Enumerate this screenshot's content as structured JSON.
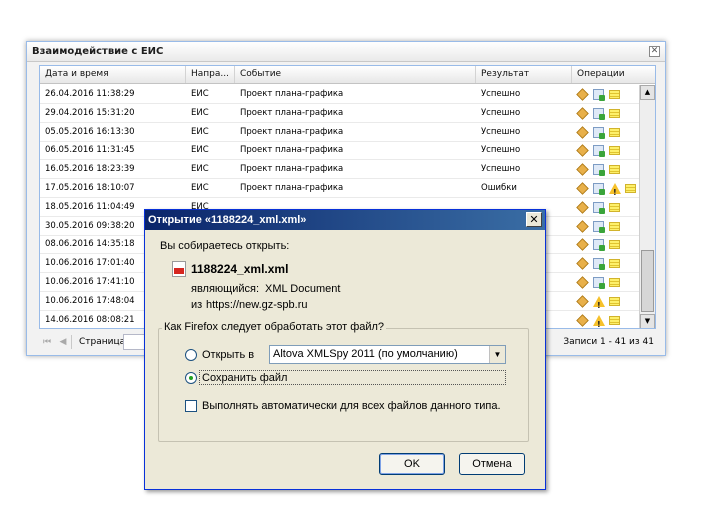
{
  "eis_window": {
    "title": "Взаимодействие с ЕИС",
    "close_glyph": "✕",
    "columns": [
      "Дата и время",
      "Напра...",
      "Событие",
      "Результат",
      "Операции"
    ],
    "rows": [
      {
        "date": "26.04.2016 11:38:29",
        "dir": "ЕИС",
        "event": "Проект плана-графика",
        "result": "Успешно",
        "ops": [
          "box",
          "doc",
          "note"
        ]
      },
      {
        "date": "29.04.2016 15:31:20",
        "dir": "ЕИС",
        "event": "Проект плана-графика",
        "result": "Успешно",
        "ops": [
          "box",
          "doc",
          "note"
        ]
      },
      {
        "date": "05.05.2016 16:13:30",
        "dir": "ЕИС",
        "event": "Проект плана-графика",
        "result": "Успешно",
        "ops": [
          "box",
          "doc",
          "note"
        ]
      },
      {
        "date": "06.05.2016 11:31:45",
        "dir": "ЕИС",
        "event": "Проект плана-графика",
        "result": "Успешно",
        "ops": [
          "box",
          "doc",
          "note"
        ]
      },
      {
        "date": "16.05.2016 18:23:39",
        "dir": "ЕИС",
        "event": "Проект плана-графика",
        "result": "Успешно",
        "ops": [
          "box",
          "doc",
          "note"
        ]
      },
      {
        "date": "17.05.2016 18:10:07",
        "dir": "ЕИС",
        "event": "Проект плана-графика",
        "result": "Ошибки",
        "ops": [
          "box",
          "doc",
          "warn",
          "note"
        ]
      },
      {
        "date": "18.05.2016 11:04:49",
        "dir": "ЕИС",
        "event": "",
        "result": "",
        "ops": [
          "box",
          "doc",
          "note"
        ]
      },
      {
        "date": "30.05.2016 09:38:20",
        "dir": "",
        "event": "",
        "result": "",
        "ops": [
          "box",
          "doc",
          "note"
        ]
      },
      {
        "date": "08.06.2016 14:35:18",
        "dir": "",
        "event": "",
        "result": "",
        "ops": [
          "box",
          "doc",
          "note"
        ]
      },
      {
        "date": "10.06.2016 17:01:40",
        "dir": "",
        "event": "",
        "result": "",
        "ops": [
          "box",
          "doc",
          "note"
        ]
      },
      {
        "date": "10.06.2016 17:41:10",
        "dir": "",
        "event": "",
        "result": "",
        "ops": [
          "box",
          "doc",
          "note"
        ]
      },
      {
        "date": "10.06.2016 17:48:04",
        "dir": "",
        "event": "",
        "result": "",
        "ops": [
          "box",
          "warn",
          "note"
        ]
      },
      {
        "date": "14.06.2016 08:08:21",
        "dir": "",
        "event": "",
        "result": "",
        "ops": [
          "box",
          "warn",
          "note"
        ]
      }
    ],
    "pager": {
      "first_glyph": "⏮",
      "prev_glyph": "◀",
      "page_label": "Страница",
      "page_value": "",
      "info": "Записи 1 - 41 из 41"
    },
    "scroll_up_glyph": "▲",
    "scroll_down_glyph": "▼"
  },
  "dialog": {
    "title": "Открытие «1188224_xml.xml»",
    "close_glyph": "✕",
    "intro": "Вы собираетесь открыть:",
    "filename": "1188224_xml.xml",
    "type_label": "являющийся:",
    "type_value": "XML Document",
    "from_label": "из",
    "from_value": "https://new.gz-spb.ru",
    "group_legend": "Как Firefox следует обработать этот файл?",
    "open_with_label": "Открыть в",
    "open_with_value": "Altova XMLSpy 2011 (по умолчанию)",
    "save_label": "Сохранить файл",
    "auto_label": "Выполнять автоматически для всех файлов данного типа.",
    "selected_option": "save",
    "ok_label": "OK",
    "cancel_label": "Отмена",
    "icons": {
      "file": "xml-file-icon",
      "dropdown": "chevron-down-icon"
    }
  }
}
